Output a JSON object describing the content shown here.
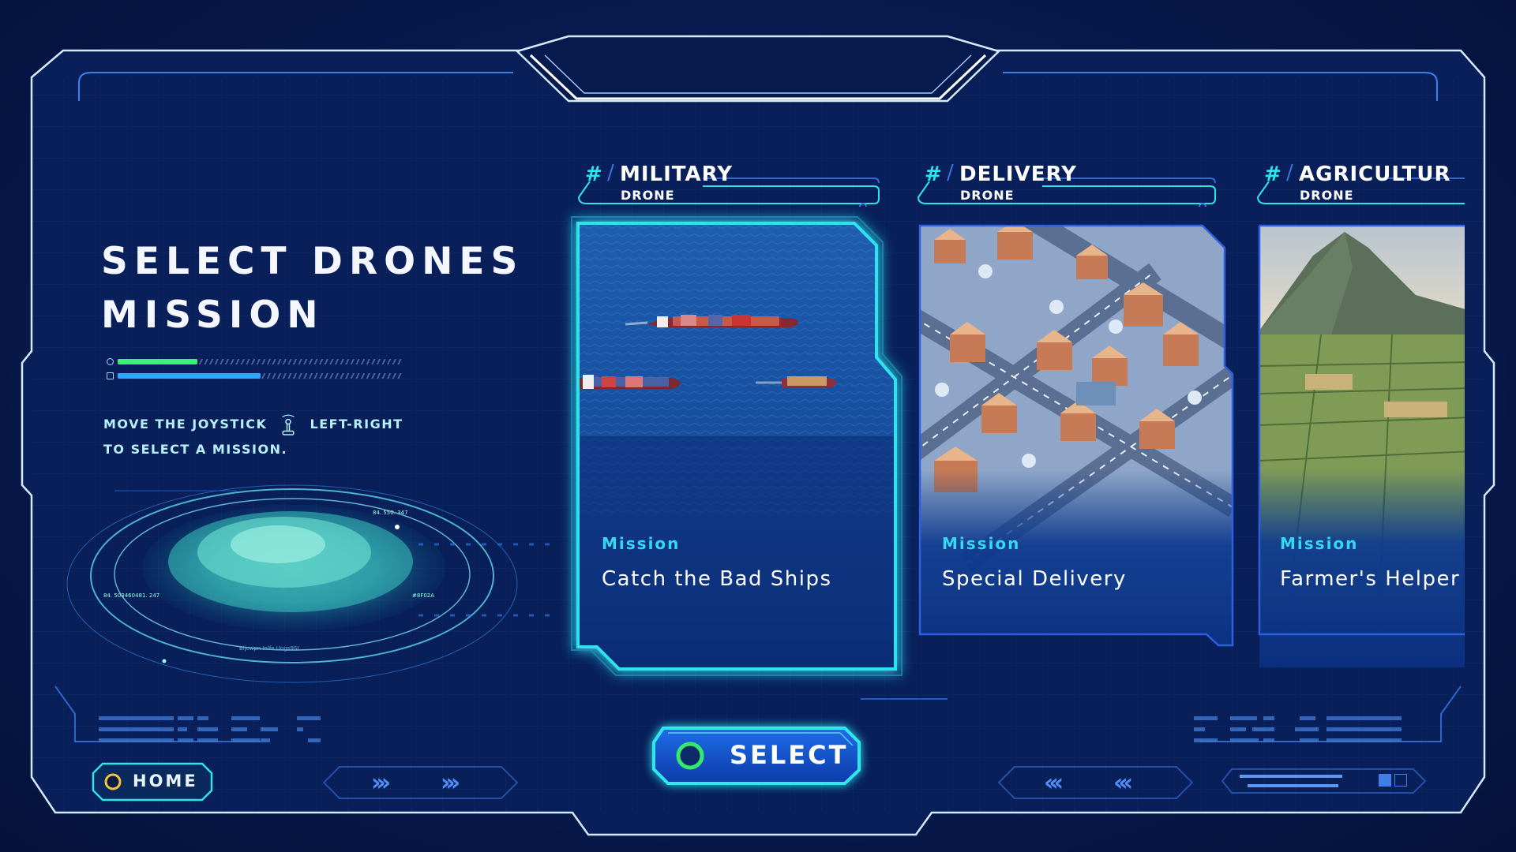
{
  "title": {
    "line1": "SELECT DRONES",
    "line2": "MISSION"
  },
  "progress": {
    "primary_fraction": 0.28,
    "secondary_fraction": 0.5,
    "primary_color": "#3df07a",
    "secondary_color": "#2ea5ff"
  },
  "instruction": {
    "part1": "MOVE THE JOYSTICK",
    "part2": "LEFT-RIGHT",
    "line2": "TO SELECT A MISSION."
  },
  "cards": [
    {
      "hash": "#",
      "name": "MILITARY",
      "sub": "DRONE",
      "mission_label": "Mission",
      "mission_name": "Catch the Bad Ships",
      "selected": true,
      "image": "cargo-ships-ocean"
    },
    {
      "hash": "#",
      "name": "DELIVERY",
      "sub": "DRONE",
      "mission_label": "Mission",
      "mission_name": "Special Delivery",
      "selected": false,
      "image": "isometric-town"
    },
    {
      "hash": "#",
      "name": "AGRICULTUR",
      "sub": "DRONE",
      "mission_label": "Mission",
      "mission_name": "Farmer's Helper",
      "selected": false,
      "image": "farm-fields-mountain"
    }
  ],
  "buttons": {
    "select": "SELECT",
    "home": "HOME"
  },
  "nav": {
    "right_arrows": "›››",
    "left_arrows": "‹‹‹"
  },
  "hologram": {
    "coord_a": "84. 550. 347",
    "coord_b": "84. 503460481. 247",
    "coord_c": "#8F02A",
    "caption": "Bljcwpn Inlfe Ungs9SL"
  },
  "colors": {
    "accent": "#27e6ef",
    "frame": "#c9e6ff",
    "panel": "#0a2460",
    "card_border": "#1f4fcf"
  },
  "icons": [
    "joystick-icon",
    "green-ring-icon",
    "yellow-ring-icon",
    "chevron-right-icon",
    "chevron-left-icon",
    "square-icon"
  ]
}
